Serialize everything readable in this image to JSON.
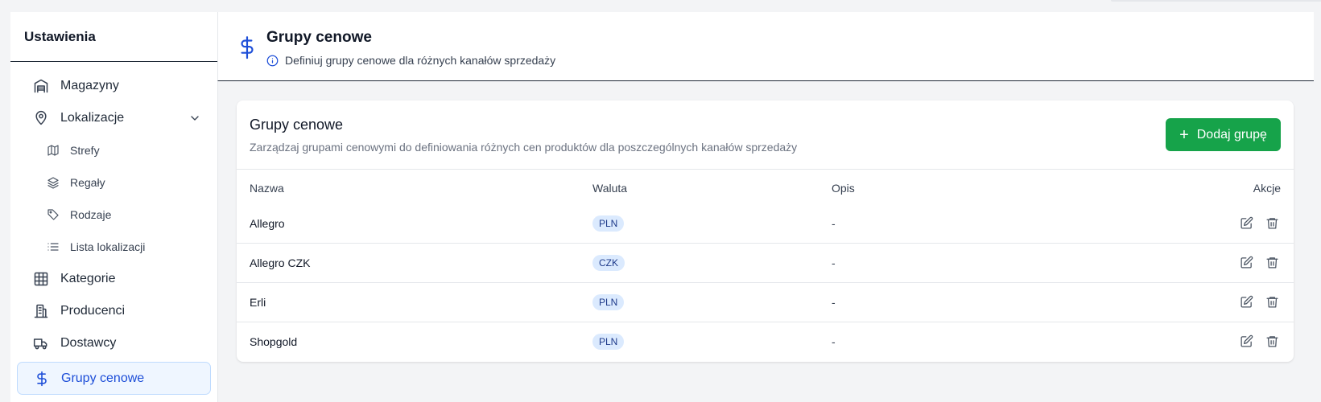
{
  "sidebar": {
    "title": "Ustawienia",
    "items": [
      {
        "label": "Magazyny",
        "icon": "warehouse-icon"
      },
      {
        "label": "Lokalizacje",
        "icon": "map-pin-icon",
        "expanded": true
      },
      {
        "label": "Strefy",
        "icon": "map-icon"
      },
      {
        "label": "Regały",
        "icon": "layers-icon"
      },
      {
        "label": "Rodzaje",
        "icon": "tag-icon"
      },
      {
        "label": "Lista lokalizacji",
        "icon": "list-icon"
      },
      {
        "label": "Kategorie",
        "icon": "grid-icon"
      },
      {
        "label": "Producenci",
        "icon": "building-icon"
      },
      {
        "label": "Dostawcy",
        "icon": "truck-icon"
      },
      {
        "label": "Grupy cenowe",
        "icon": "dollar-icon",
        "active": true
      }
    ]
  },
  "header": {
    "title": "Grupy cenowe",
    "subtitle": "Definiuj grupy cenowe dla różnych kanałów sprzedaży"
  },
  "card": {
    "title": "Grupy cenowe",
    "description": "Zarządzaj grupami cenowymi do definiowania różnych cen produktów dla poszczególnych kanałów sprzedaży",
    "add_button": "Dodaj grupę"
  },
  "table": {
    "columns": [
      "Nazwa",
      "Waluta",
      "Opis",
      "Akcje"
    ],
    "rows": [
      {
        "name": "Allegro",
        "currency": "PLN",
        "description": "-"
      },
      {
        "name": "Allegro CZK",
        "currency": "CZK",
        "description": "-"
      },
      {
        "name": "Erli",
        "currency": "PLN",
        "description": "-"
      },
      {
        "name": "Shopgold",
        "currency": "PLN",
        "description": "-"
      }
    ]
  },
  "colors": {
    "accent": "#1d4ed8",
    "add_button": "#16a34a",
    "badge_bg": "#dbeafe"
  }
}
